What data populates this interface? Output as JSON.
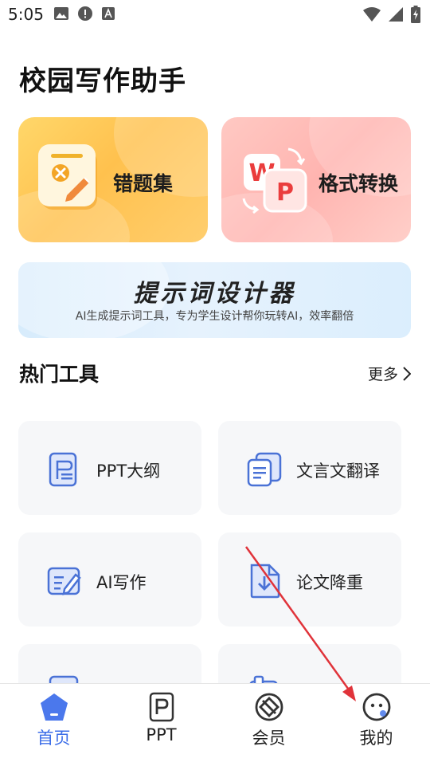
{
  "status_bar": {
    "time": "5:05"
  },
  "page": {
    "title": "校园写作助手"
  },
  "feature_cards": [
    {
      "title": "错题集"
    },
    {
      "title": "格式转换",
      "icon_letters": [
        "W",
        "P"
      ]
    }
  ],
  "banner": {
    "title": "提示词设计器",
    "subtitle": "AI生成提示词工具，专为学生设计帮你玩转AI，效率翻倍"
  },
  "hot_tools": {
    "title": "热门工具",
    "more_label": "更多",
    "items": [
      {
        "label": "PPT大纲",
        "icon": "outline-doc-icon"
      },
      {
        "label": "文言文翻译",
        "icon": "translate-doc-icon"
      },
      {
        "label": "AI写作",
        "icon": "write-icon"
      },
      {
        "label": "论文降重",
        "icon": "download-doc-icon"
      }
    ]
  },
  "tab_bar": {
    "tabs": [
      {
        "label": "首页",
        "active": true
      },
      {
        "label": "PPT",
        "active": false
      },
      {
        "label": "会员",
        "active": false
      },
      {
        "label": "我的",
        "active": false
      }
    ]
  },
  "colors": {
    "accent": "#3c6ee8",
    "annotation_arrow": "#e0333a"
  }
}
